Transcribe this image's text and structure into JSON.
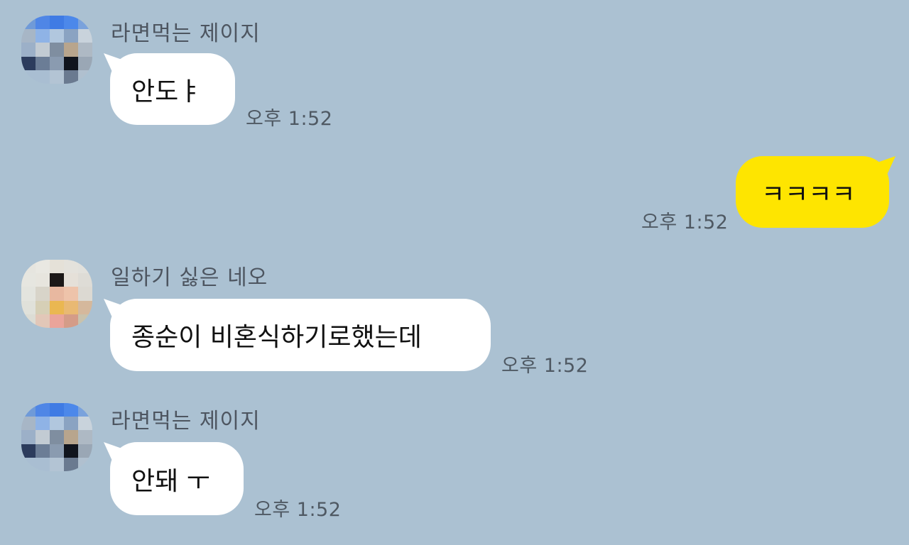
{
  "messages": [
    {
      "sender": "라면먹는 제이지",
      "text": "안도ㅑ",
      "time": "오후 1:52",
      "avatar_colors": [
        "#6f9ad8",
        "#4f86e6",
        "#3f7be4",
        "#4c88ea",
        "#7aa2dc",
        "#a7b6c6",
        "#8fb3e6",
        "#b1c7de",
        "#8aa3c2",
        "#c9d3dc",
        "#9cb0c8",
        "#c2cbd3",
        "#7f8ea0",
        "#b8a58d",
        "#aeb9c4",
        "#2c3c5d",
        "#6b7d96",
        "#8a9bb0",
        "#10141d",
        "#9aa7b5",
        "#a9bed2",
        "#a9bed2",
        "#b3c4d4",
        "#6a7a90",
        "#b0c0cf"
      ]
    },
    {
      "mine": true,
      "text": "ㅋㅋㅋㅋ",
      "time": "오후 1:52"
    },
    {
      "sender": "일하기 싫은 네오",
      "text": "종순이 비혼식하기로했는데",
      "time": "오후 1:52",
      "avatar_colors": [
        "#e6e5df",
        "#e9e8e2",
        "#e5e1d8",
        "#e4e2dc",
        "#e2e1dc",
        "#e6e6e0",
        "#e7e5de",
        "#1c1817",
        "#e5e0d8",
        "#dedcd6",
        "#e3e4de",
        "#d8d4c9",
        "#e8b8a0",
        "#eec3aa",
        "#dcd9d2",
        "#e0e1da",
        "#d6cfb6",
        "#eab751",
        "#e9b973",
        "#d5b89c",
        "#dcdcd4",
        "#e2c7b8",
        "#eaa49a",
        "#d49c88",
        "#c9c2ac"
      ]
    },
    {
      "sender": "라면먹는 제이지",
      "text": "안돼 ㅜ",
      "time": "오후 1:52",
      "avatar_colors": [
        "#6f9ad8",
        "#4f86e6",
        "#3f7be4",
        "#4c88ea",
        "#7aa2dc",
        "#a7b6c6",
        "#8fb3e6",
        "#b1c7de",
        "#8aa3c2",
        "#c9d3dc",
        "#9cb0c8",
        "#c2cbd3",
        "#7f8ea0",
        "#b8a58d",
        "#aeb9c4",
        "#2c3c5d",
        "#6b7d96",
        "#8a9bb0",
        "#10141d",
        "#9aa7b5",
        "#a9bed2",
        "#a9bed2",
        "#b3c4d4",
        "#6a7a90",
        "#b0c0cf"
      ]
    }
  ],
  "colors": {
    "background": "#abc1d2",
    "incoming_bubble": "#ffffff",
    "outgoing_bubble": "#fee500"
  }
}
